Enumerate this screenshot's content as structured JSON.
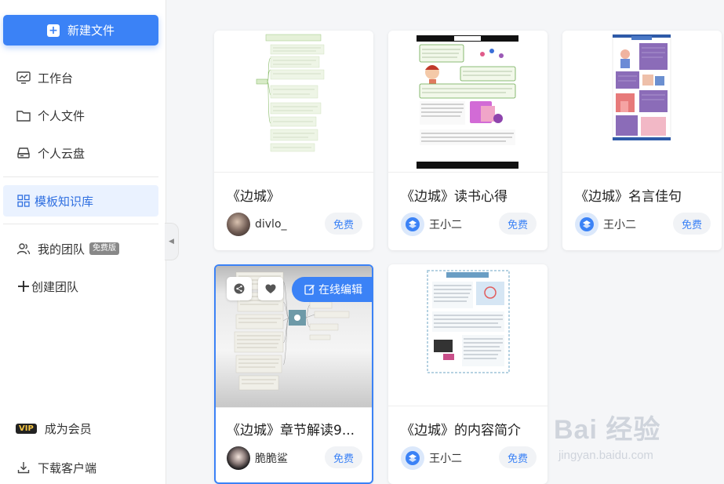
{
  "sidebar": {
    "new_file": "新建文件",
    "items": [
      {
        "label": "工作台",
        "icon": "monitor-icon"
      },
      {
        "label": "个人文件",
        "icon": "folder-icon"
      },
      {
        "label": "个人云盘",
        "icon": "cloud-disk-icon"
      },
      {
        "label": "模板知识库",
        "icon": "grid-icon"
      },
      {
        "label": "我的团队",
        "icon": "team-icon",
        "badge": "免费版"
      },
      {
        "label": "创建团队",
        "icon": "plus-icon"
      },
      {
        "label": "成为会员",
        "icon": "vip-icon",
        "vip": "VIP"
      },
      {
        "label": "下载客户端",
        "icon": "download-icon"
      }
    ]
  },
  "cards": [
    {
      "title": "《边城》",
      "author": "divlo_",
      "price": "免费"
    },
    {
      "title": "《边城》读书心得",
      "author": "王小二",
      "price": "免费"
    },
    {
      "title": "《边城》名言佳句",
      "author": "王小二",
      "price": "免费"
    },
    {
      "title": "《边城》章节解读9...",
      "author": "脆脆鲨",
      "price": "免费",
      "edit": "在线编辑"
    },
    {
      "title": "《边城》的内容简介",
      "author": "王小二",
      "price": "免费"
    }
  ],
  "watermark": {
    "main": "Bai 经验",
    "sub": "jingyan.baidu.com"
  },
  "colors": {
    "accent": "#3b82f6",
    "active_bg": "#eaf2ff"
  }
}
